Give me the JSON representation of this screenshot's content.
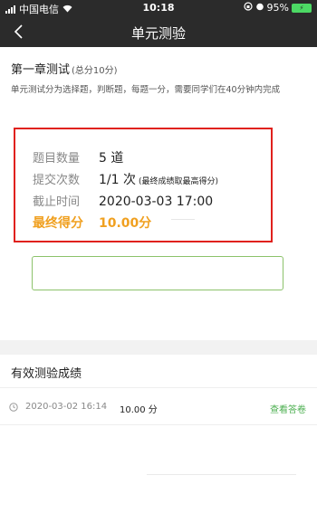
{
  "status_bar": {
    "carrier": "中国电信",
    "time": "10:18",
    "battery": "95%"
  },
  "nav": {
    "title": "单元测验"
  },
  "chapter": {
    "title": "第一章测试",
    "score": "(总分10分)",
    "description": "单元测试分为选择题，判断题，每题一分，需要同学们在40分钟内完成"
  },
  "info": {
    "question_count_label": "题目数量",
    "question_count_value": "5 道",
    "submit_count_label": "提交次数",
    "submit_count_value": "1/1 次",
    "submit_count_note": "(最终成绩取最高得分)",
    "deadline_label": "截止时间",
    "deadline_value": "2020-03-03 17:00",
    "final_score_label": "最终得分",
    "final_score_value": "10.00分"
  },
  "results": {
    "title": "有效测验成绩",
    "rows": [
      {
        "time": "2020-03-02 16:14",
        "score": "10.00 分",
        "action": "查看答卷"
      }
    ]
  },
  "colors": {
    "header_bg": "#2b2b2b",
    "highlight_border": "#e0211d",
    "final_score": "#f0a020",
    "action_green": "#4caf50"
  }
}
